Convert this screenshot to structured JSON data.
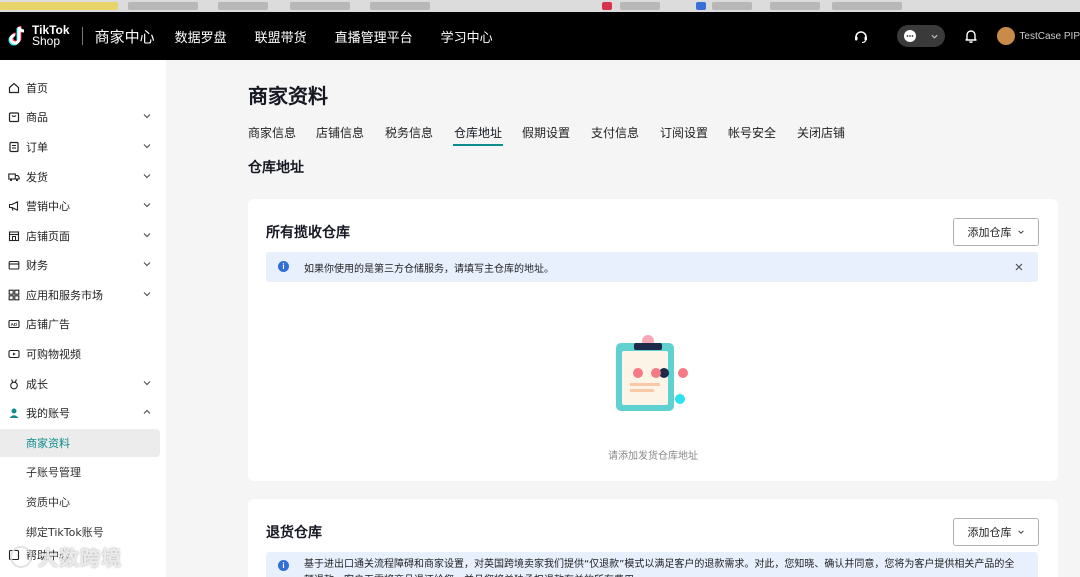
{
  "header": {
    "logo_line1": "TikTok",
    "logo_line2": "Shop",
    "brand_title": "商家中心",
    "nav": [
      {
        "label": "数据罗盘"
      },
      {
        "label": "联盟带货"
      },
      {
        "label": "直播管理平台"
      },
      {
        "label": "学习中心"
      }
    ],
    "user_name": "TestCase PIP"
  },
  "sidebar": {
    "items": [
      {
        "label": "首页",
        "icon": "home-icon",
        "has_chevron": false
      },
      {
        "label": "商品",
        "icon": "product-icon",
        "has_chevron": true
      },
      {
        "label": "订单",
        "icon": "order-icon",
        "has_chevron": true
      },
      {
        "label": "发货",
        "icon": "truck-icon",
        "has_chevron": true
      },
      {
        "label": "营销中心",
        "icon": "megaphone-icon",
        "has_chevron": true
      },
      {
        "label": "店铺页面",
        "icon": "store-icon",
        "has_chevron": true
      },
      {
        "label": "财务",
        "icon": "wallet-icon",
        "has_chevron": true
      },
      {
        "label": "应用和服务市场",
        "icon": "apps-icon",
        "has_chevron": true
      },
      {
        "label": "店铺广告",
        "icon": "ad-icon",
        "has_chevron": false
      },
      {
        "label": "可购物视频",
        "icon": "video-icon",
        "has_chevron": false
      },
      {
        "label": "成长",
        "icon": "medal-icon",
        "has_chevron": true
      },
      {
        "label": "我的账号",
        "icon": "user-icon",
        "has_chevron": true
      }
    ],
    "sub_items": [
      {
        "label": "商家资料",
        "active": true
      },
      {
        "label": "子账号管理",
        "active": false
      },
      {
        "label": "资质中心",
        "active": false
      },
      {
        "label": "绑定TikTok账号",
        "active": false
      }
    ],
    "last_item": "帮助中心"
  },
  "main": {
    "page_title": "商家资料",
    "tabs": [
      {
        "label": "商家信息"
      },
      {
        "label": "店铺信息"
      },
      {
        "label": "税务信息"
      },
      {
        "label": "仓库地址",
        "active": true
      },
      {
        "label": "假期设置"
      },
      {
        "label": "支付信息"
      },
      {
        "label": "订阅设置"
      },
      {
        "label": "帐号安全"
      },
      {
        "label": "关闭店铺"
      }
    ],
    "section_heading": "仓库地址",
    "pickup_card": {
      "title": "所有揽收仓库",
      "add_button": "添加仓库",
      "notice": "如果你使用的是第三方仓储服务，请填写主仓库的地址。",
      "empty_text": "请添加发货仓库地址"
    },
    "return_card": {
      "title": "退货仓库",
      "add_button": "添加仓库",
      "notice": "基于进出口通关流程障碍和商家设置，对英国跨境卖家我们提供“仅退款”模式以满足客户的退款需求。对此，您知晓、确认并同意，您将为客户提供相关产品的全额退款，客户无需将商品退还给您，并且您将单独承担退款有关的所有费用。"
    }
  },
  "watermark": {
    "text": "大数跨境"
  },
  "colors": {
    "accent": "#0f8b8d",
    "notice_bg": "#e8f0fe",
    "info_blue": "#2f6fd6",
    "topbar": "#000000"
  }
}
